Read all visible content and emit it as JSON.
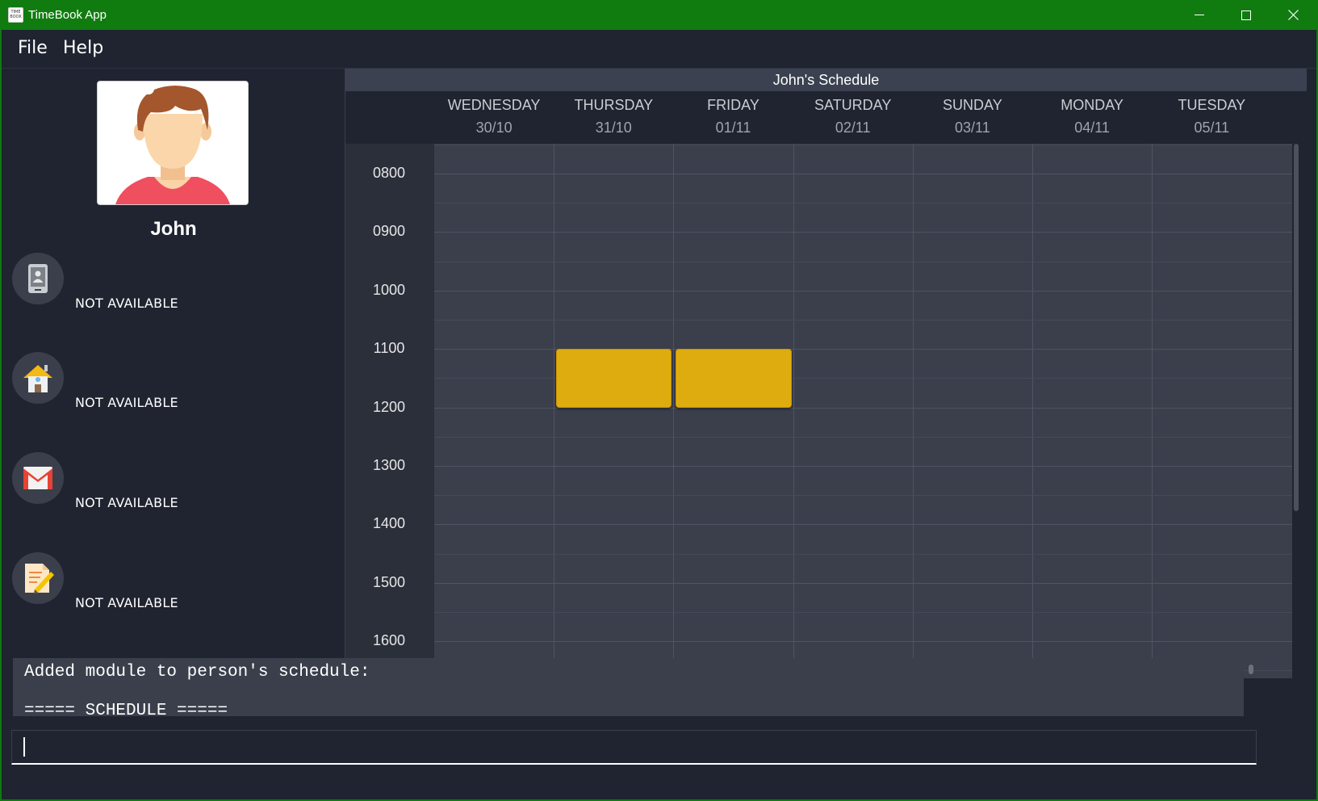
{
  "window": {
    "title": "TimeBook App",
    "icon_text": "TIME BOOK",
    "accent": "#107c10"
  },
  "menu": [
    {
      "label": "File"
    },
    {
      "label": "Help"
    }
  ],
  "profile": {
    "name": "John",
    "fields": [
      {
        "icon": "phone-icon",
        "value": "NOT AVAILABLE"
      },
      {
        "icon": "home-icon",
        "value": "NOT AVAILABLE"
      },
      {
        "icon": "email-icon",
        "value": "NOT AVAILABLE"
      },
      {
        "icon": "notes-icon",
        "value": "NOT AVAILABLE"
      }
    ]
  },
  "schedule": {
    "title": "John's Schedule",
    "days": [
      {
        "name": "WEDNESDAY",
        "date": "30/10"
      },
      {
        "name": "THURSDAY",
        "date": "31/10"
      },
      {
        "name": "FRIDAY",
        "date": "01/11"
      },
      {
        "name": "SATURDAY",
        "date": "02/11"
      },
      {
        "name": "SUNDAY",
        "date": "03/11"
      },
      {
        "name": "MONDAY",
        "date": "04/11"
      },
      {
        "name": "TUESDAY",
        "date": "05/11"
      }
    ],
    "times": [
      "0800",
      "0900",
      "1000",
      "1100",
      "1200",
      "1300",
      "1400",
      "1500",
      "1600"
    ],
    "blocks": [
      {
        "day": "THURSDAY",
        "start": "1100",
        "end": "1200",
        "color": "#dfac0f"
      },
      {
        "day": "FRIDAY",
        "start": "1100",
        "end": "1200",
        "color": "#dfac0f"
      }
    ]
  },
  "result": {
    "lines": [
      "Added module to person's schedule:",
      "",
      "===== SCHEDULE ====="
    ]
  },
  "command": {
    "value": ""
  }
}
